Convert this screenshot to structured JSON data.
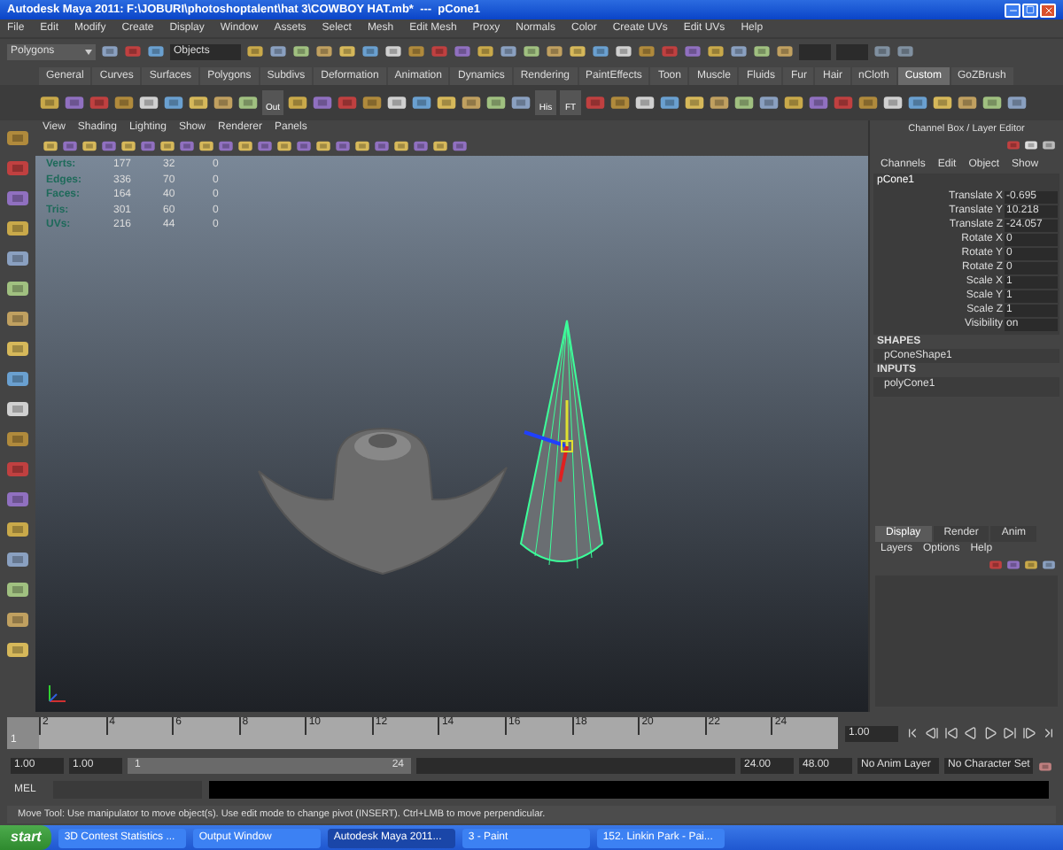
{
  "window": {
    "title": "Autodesk Maya 2011: F:\\JOBURI\\photoshoptalent\\hat 3\\COWBOY HAT.mb*  ---  pCone1"
  },
  "menu_bar": [
    "File",
    "Edit",
    "Modify",
    "Create",
    "Display",
    "Window",
    "Assets",
    "Select",
    "Mesh",
    "Edit Mesh",
    "Proxy",
    "Normals",
    "Color",
    "Create UVs",
    "Edit UVs",
    "Help"
  ],
  "status_line": {
    "mode": "Polygons",
    "selection_field": "Objects"
  },
  "shelf_tabs": [
    {
      "label": "General",
      "selected": false
    },
    {
      "label": "Curves",
      "selected": false
    },
    {
      "label": "Surfaces",
      "selected": false
    },
    {
      "label": "Polygons",
      "selected": false
    },
    {
      "label": "Subdivs",
      "selected": false
    },
    {
      "label": "Deformation",
      "selected": false
    },
    {
      "label": "Animation",
      "selected": false
    },
    {
      "label": "Dynamics",
      "selected": false
    },
    {
      "label": "Rendering",
      "selected": false
    },
    {
      "label": "PaintEffects",
      "selected": false
    },
    {
      "label": "Toon",
      "selected": false
    },
    {
      "label": "Muscle",
      "selected": false
    },
    {
      "label": "Fluids",
      "selected": false
    },
    {
      "label": "Fur",
      "selected": false
    },
    {
      "label": "Hair",
      "selected": false
    },
    {
      "label": "nCloth",
      "selected": false
    },
    {
      "label": "Custom",
      "selected": true
    },
    {
      "label": "GoZBrush",
      "selected": false
    }
  ],
  "shelf_labeled_tools": [
    {
      "label": "Out"
    },
    {
      "label": "His"
    },
    {
      "label": "FT"
    }
  ],
  "viewport": {
    "menu": [
      "View",
      "Shading",
      "Lighting",
      "Show",
      "Renderer",
      "Panels"
    ],
    "stats": [
      {
        "label": "Verts:",
        "values": [
          "177",
          "32",
          "0"
        ]
      },
      {
        "label": "Edges:",
        "values": [
          "336",
          "70",
          "0"
        ]
      },
      {
        "label": "Faces:",
        "values": [
          "164",
          "40",
          "0"
        ]
      },
      {
        "label": "Tris:",
        "values": [
          "301",
          "60",
          "0"
        ]
      },
      {
        "label": "UVs:",
        "values": [
          "216",
          "44",
          "0"
        ]
      }
    ]
  },
  "channel_box": {
    "title": "Channel Box / Layer Editor",
    "menu": [
      "Channels",
      "Edit",
      "Object",
      "Show"
    ],
    "object": "pCone1",
    "attributes": [
      {
        "name": "Translate X",
        "value": "-0.695"
      },
      {
        "name": "Translate Y",
        "value": "10.218"
      },
      {
        "name": "Translate Z",
        "value": "-24.057"
      },
      {
        "name": "Rotate X",
        "value": "0"
      },
      {
        "name": "Rotate Y",
        "value": "0"
      },
      {
        "name": "Rotate Z",
        "value": "0"
      },
      {
        "name": "Scale X",
        "value": "1"
      },
      {
        "name": "Scale Y",
        "value": "1"
      },
      {
        "name": "Scale Z",
        "value": "1"
      },
      {
        "name": "Visibility",
        "value": "on"
      }
    ],
    "shapes_header": "SHAPES",
    "shape": "pConeShape1",
    "inputs_header": "INPUTS",
    "input": "polyCone1"
  },
  "layer_editor": {
    "tabs": [
      {
        "label": "Display",
        "selected": true
      },
      {
        "label": "Render",
        "selected": false
      },
      {
        "label": "Anim",
        "selected": false
      }
    ],
    "menu": [
      "Layers",
      "Options",
      "Help"
    ]
  },
  "time_slider": {
    "start_label": "1",
    "ticks": [
      "2",
      "4",
      "6",
      "8",
      "10",
      "12",
      "14",
      "16",
      "18",
      "20",
      "22",
      "24"
    ],
    "current_frame": "1.00"
  },
  "range_slider": {
    "start": "1.00",
    "playback_start": "1.00",
    "range_start": "1",
    "range_end": "24",
    "playback_end": "24.00",
    "end": "48.00",
    "anim_layer": "No Anim Layer",
    "character_set": "No Character Set"
  },
  "command_line": {
    "label": "MEL"
  },
  "help_line": "Move Tool: Use manipulator to move object(s). Use edit mode to change pivot (INSERT). Ctrl+LMB to move perpendicular.",
  "taskbar": {
    "start": "start",
    "items": [
      {
        "label": "3D Contest Statistics ...",
        "selected": false
      },
      {
        "label": "Output Window",
        "selected": false
      },
      {
        "label": "Autodesk Maya 2011...",
        "selected": true
      },
      {
        "label": "3 - Paint",
        "selected": false
      },
      {
        "label": "152. Linkin Park - Pai...",
        "selected": false
      }
    ]
  }
}
